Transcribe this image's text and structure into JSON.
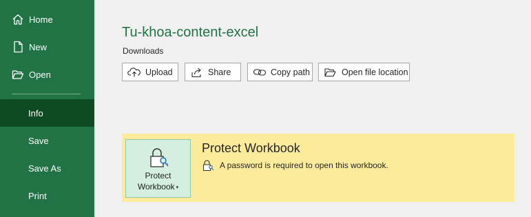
{
  "sidebar": {
    "items": [
      {
        "label": "Home",
        "icon": "home-icon"
      },
      {
        "label": "New",
        "icon": "new-document-icon"
      },
      {
        "label": "Open",
        "icon": "open-folder-icon"
      },
      {
        "label": "Info",
        "active": true
      },
      {
        "label": "Save"
      },
      {
        "label": "Save As"
      },
      {
        "label": "Print"
      }
    ]
  },
  "document": {
    "title": "Tu-khoa-content-excel",
    "location": "Downloads"
  },
  "actions": [
    {
      "label": "Upload",
      "icon": "upload-icon"
    },
    {
      "label": "Share",
      "icon": "share-icon"
    },
    {
      "label": "Copy path",
      "icon": "link-icon"
    },
    {
      "label": "Open file location",
      "icon": "folder-icon"
    }
  ],
  "protect": {
    "button_line1": "Protect",
    "button_line2": "Workbook",
    "title": "Protect Workbook",
    "description": "A password is required to open this workbook."
  },
  "colors": {
    "sidebar": "#217346",
    "sidebar_active": "#0e4a23",
    "accent_text": "#217346",
    "protect_panel": "#fbeb9b"
  }
}
